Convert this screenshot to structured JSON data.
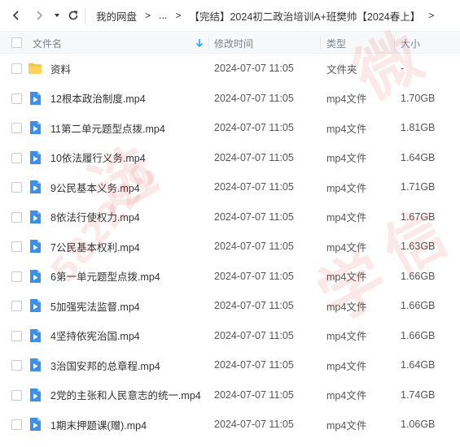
{
  "nav": {
    "breadcrumb": [
      "我的网盘",
      "...",
      "【完结】2024初二政治培训A+班樊帅【2024春上】"
    ]
  },
  "header": {
    "name_label": "文件名",
    "mtime_label": "修改时间",
    "type_label": "类型",
    "size_label": "大小"
  },
  "files": [
    {
      "name": "资料",
      "mtime": "2024-07-07 11:05",
      "type": "文件夹",
      "size": "-",
      "icon": "folder-icon"
    },
    {
      "name": "12根本政治制度.mp4",
      "mtime": "2024-07-07 11:05",
      "type": "mp4文件",
      "size": "1.70GB",
      "icon": "video-file-icon"
    },
    {
      "name": "11第二单元题型点拨.mp4",
      "mtime": "2024-07-07 11:05",
      "type": "mp4文件",
      "size": "1.81GB",
      "icon": "video-file-icon"
    },
    {
      "name": "10依法履行义务.mp4",
      "mtime": "2024-07-07 11:05",
      "type": "mp4文件",
      "size": "1.64GB",
      "icon": "video-file-icon"
    },
    {
      "name": "9公民基本义务.mp4",
      "mtime": "2024-07-07 11:05",
      "type": "mp4文件",
      "size": "1.71GB",
      "icon": "video-file-icon"
    },
    {
      "name": "8依法行使权力.mp4",
      "mtime": "2024-07-07 11:05",
      "type": "mp4文件",
      "size": "1.67GB",
      "icon": "video-file-icon"
    },
    {
      "name": "7公民基本权利.mp4",
      "mtime": "2024-07-07 11:05",
      "type": "mp4文件",
      "size": "1.63GB",
      "icon": "video-file-icon"
    },
    {
      "name": "6第一单元题型点拨.mp4",
      "mtime": "2024-07-07 11:05",
      "type": "mp4文件",
      "size": "1.66GB",
      "icon": "video-file-icon"
    },
    {
      "name": "5加强宪法监督.mp4",
      "mtime": "2024-07-07 11:05",
      "type": "mp4文件",
      "size": "1.66GB",
      "icon": "video-file-icon"
    },
    {
      "name": "4坚持依宪治国.mp4",
      "mtime": "2024-07-07 11:05",
      "type": "mp4文件",
      "size": "1.66GB",
      "icon": "video-file-icon"
    },
    {
      "name": "3治国安邦的总章程.mp4",
      "mtime": "2024-07-07 11:05",
      "type": "mp4文件",
      "size": "1.64GB",
      "icon": "video-file-icon"
    },
    {
      "name": "2党的主张和人民意志的统一.mp4",
      "mtime": "2024-07-07 11:05",
      "type": "mp4文件",
      "size": "1.74GB",
      "icon": "video-file-icon"
    },
    {
      "name": "1期末押题课(赠).mp4",
      "mtime": "2024-07-07 11:05",
      "type": "mp4文件",
      "size": "1.06GB",
      "icon": "video-file-icon"
    }
  ],
  "watermark": {
    "chars": [
      "微",
      "信",
      "学",
      "选",
      "582229"
    ]
  },
  "colors": {
    "accent": "#06a7ff",
    "folder": "#f7c34a",
    "video_icon": "#3d8fe8",
    "header_bg": "#f7f8fa"
  }
}
